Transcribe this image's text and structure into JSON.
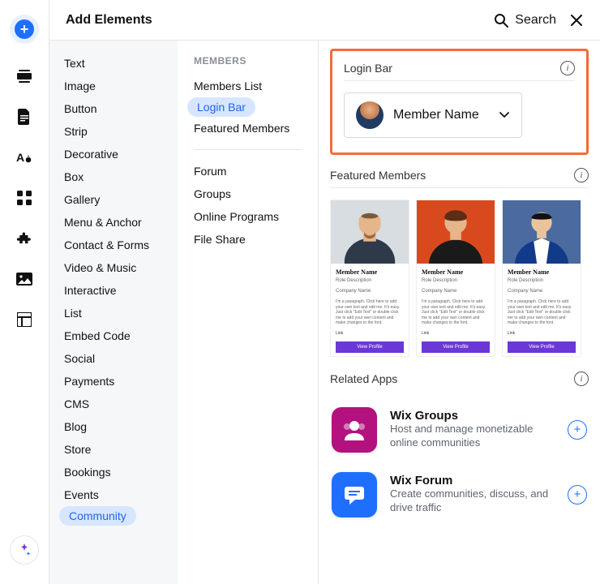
{
  "header": {
    "title": "Add Elements",
    "search_label": "Search"
  },
  "categories": [
    "Text",
    "Image",
    "Button",
    "Strip",
    "Decorative",
    "Box",
    "Gallery",
    "Menu & Anchor",
    "Contact & Forms",
    "Video & Music",
    "Interactive",
    "List",
    "Embed Code",
    "Social",
    "Payments",
    "CMS",
    "Blog",
    "Store",
    "Bookings",
    "Events",
    "Community"
  ],
  "categories_selected_index": 20,
  "sub": {
    "heading": "MEMBERS",
    "group1": [
      "Members List",
      "Login Bar",
      "Featured Members"
    ],
    "selected_index": 1,
    "group2": [
      "Forum",
      "Groups",
      "Online Programs",
      "File Share"
    ]
  },
  "login_bar": {
    "section_title": "Login Bar",
    "chip_label": "Member Name"
  },
  "featured": {
    "section_title": "Featured Members",
    "card_name": "Member Name",
    "card_role": "Role Description",
    "card_company": "Company Name",
    "card_para": "I'm a paragraph. Click here to add your own text and edit me. It's easy. Just click \"Edit Text\" or double click me to add your own content and make changes to the font.",
    "card_link": "Link",
    "card_btn": "View Profile"
  },
  "related": {
    "section_title": "Related Apps",
    "apps": [
      {
        "title": "Wix Groups",
        "desc": "Host and manage monetizable online communities"
      },
      {
        "title": "Wix Forum",
        "desc": "Create communities, discuss, and drive traffic"
      }
    ]
  },
  "icons": {
    "search": "search-icon",
    "close": "close-icon",
    "info": "info-icon",
    "chevron_down": "chevron-down-icon",
    "plus": "plus-icon"
  }
}
